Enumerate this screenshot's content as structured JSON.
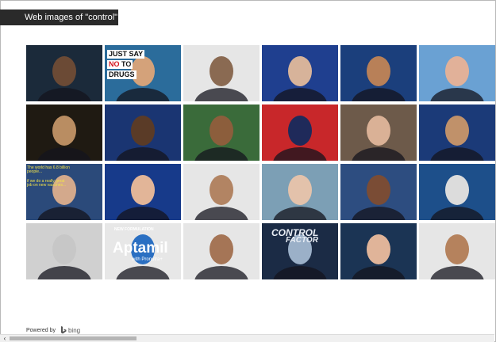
{
  "search": {
    "label": "Web images of \"control\""
  },
  "tiles": [
    {
      "name": "image-woman-portrait",
      "bg": "#1b2a3a",
      "face": "#6b4a35"
    },
    {
      "name": "image-just-say-no",
      "bg": "#2b6c9b",
      "face": "#d4a27a",
      "line1": "JUST SAY",
      "line2_pre": "",
      "line2_no": "NO",
      "line2_post": " TO",
      "line3": "DRUGS"
    },
    {
      "name": "image-blue-hoodie",
      "bg": "#e6e6e6",
      "face": "#8a6a52"
    },
    {
      "name": "image-putin-flag",
      "bg": "#1f3f8f",
      "face": "#d7b39a"
    },
    {
      "name": "image-young-man",
      "bg": "#1b3f7c",
      "face": "#b88058"
    },
    {
      "name": "image-smiling-man",
      "bg": "#6aa1d3",
      "face": "#e1b199"
    },
    {
      "name": "image-goggles-man",
      "bg": "#1f1a12",
      "face": "#b98d62"
    },
    {
      "name": "image-rapper-portrait",
      "bg": "#1a3572",
      "face": "#5a3b27"
    },
    {
      "name": "image-cap-man",
      "bg": "#3a6b3a",
      "face": "#8c5e3c"
    },
    {
      "name": "image-poster-art",
      "bg": "#c8272a",
      "face": "#1f2a5a"
    },
    {
      "name": "image-older-man",
      "bg": "#6d5a4a",
      "face": "#dab196"
    },
    {
      "name": "image-performer",
      "bg": "#1b3a78",
      "face": "#c0916a"
    },
    {
      "name": "image-gates-text",
      "bg": "#2b4a7a",
      "face": "#d3a98c",
      "line1": "The world has 6.8 billion people...",
      "line2": "if we do a really great job on new vaccines..."
    },
    {
      "name": "image-flag-man",
      "bg": "#173a8a",
      "face": "#e2b598"
    },
    {
      "name": "image-couple",
      "bg": "#e6e6e6",
      "face": "#b28463"
    },
    {
      "name": "image-selfie-couple",
      "bg": "#7c9fb5",
      "face": "#e3c2ab"
    },
    {
      "name": "image-news-woman",
      "bg": "#2d4d80",
      "face": "#7a4c35"
    },
    {
      "name": "image-infographic",
      "bg": "#1d4f8a",
      "face": "#dcdcdc"
    },
    {
      "name": "image-remote-control",
      "bg": "#d0d0d0",
      "face": "#c7c7c7"
    },
    {
      "name": "image-aptamil",
      "bg": "#e7e7e7",
      "face": "#2a6fc2",
      "line1": "NEW FORMULATION",
      "brand": "Aptamil",
      "sub": "with Pronutra+"
    },
    {
      "name": "image-driver-man",
      "bg": "#e6e6e6",
      "face": "#a57556"
    },
    {
      "name": "image-control-factor",
      "bg": "#1b2b45",
      "face": "#9bb0c8",
      "line1": "CONTROL",
      "line2": "FACTOR"
    },
    {
      "name": "image-politician",
      "bg": "#1b3454",
      "face": "#e0b499"
    },
    {
      "name": "image-woman-smiling",
      "bg": "#e6e6e6",
      "face": "#b5825d"
    }
  ],
  "footer": {
    "powered_by": "Powered by",
    "brand": "bing"
  }
}
